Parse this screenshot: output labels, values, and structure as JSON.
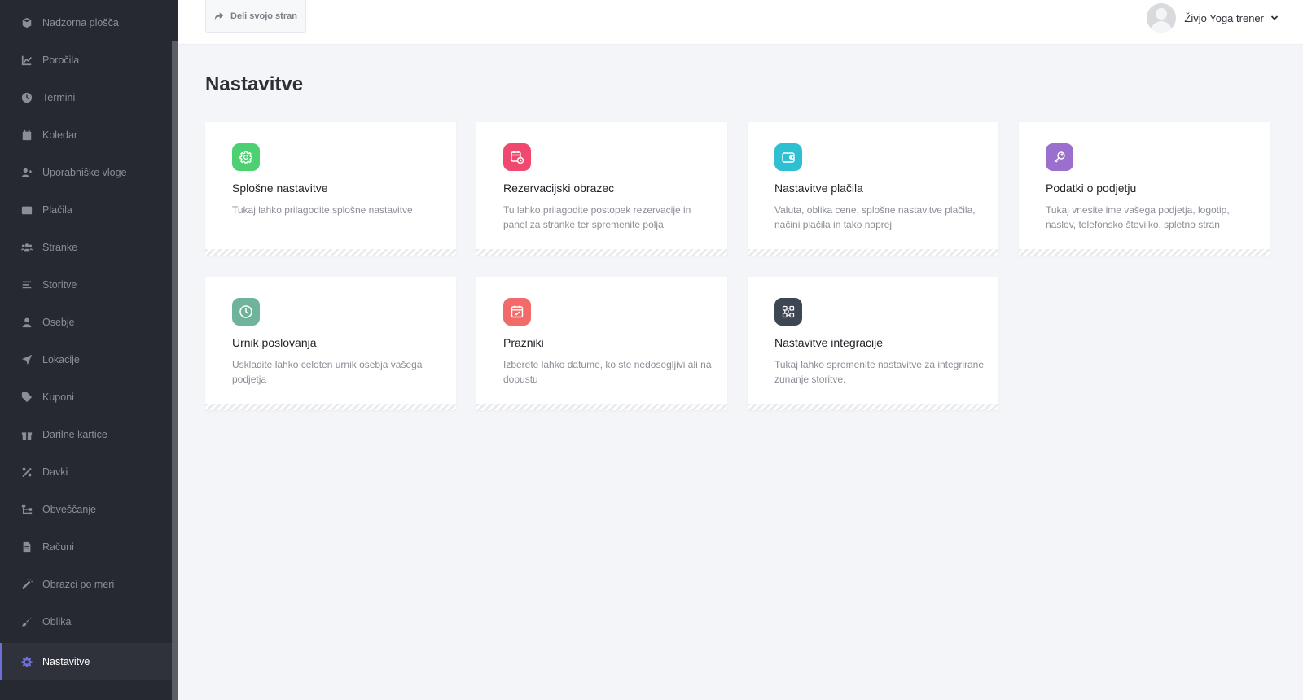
{
  "sidebar": {
    "items": [
      {
        "label": "Nadzorna plošča",
        "icon": "dashboard-icon"
      },
      {
        "label": "Poročila",
        "icon": "chart-line-icon"
      },
      {
        "label": "Termini",
        "icon": "clock-icon"
      },
      {
        "label": "Koledar",
        "icon": "calendar-icon"
      },
      {
        "label": "Uporabniške vloge",
        "icon": "user-plus-icon"
      },
      {
        "label": "Plačila",
        "icon": "wallet-icon"
      },
      {
        "label": "Stranke",
        "icon": "users-icon"
      },
      {
        "label": "Storitve",
        "icon": "list-icon"
      },
      {
        "label": "Osebje",
        "icon": "user-icon"
      },
      {
        "label": "Lokacije",
        "icon": "location-arrow-icon"
      },
      {
        "label": "Kuponi",
        "icon": "tag-icon"
      },
      {
        "label": "Darilne kartice",
        "icon": "gift-icon"
      },
      {
        "label": "Davki",
        "icon": "percent-icon"
      },
      {
        "label": "Obveščanje",
        "icon": "sitemap-icon"
      },
      {
        "label": "Računi",
        "icon": "invoice-icon"
      },
      {
        "label": "Obrazci po meri",
        "icon": "magic-wand-icon"
      },
      {
        "label": "Oblika",
        "icon": "paint-brush-icon"
      },
      {
        "label": "Nastavitve",
        "icon": "gear-icon",
        "active": true
      }
    ]
  },
  "topbar": {
    "share_label": "Deli svojo stran",
    "user_name": "Živjo Yoga trener"
  },
  "page": {
    "title": "Nastavitve"
  },
  "cards": [
    {
      "title": "Splošne nastavitve",
      "desc": "Tukaj lahko prilagodite splošne nastavitve",
      "icon": "gear-icon",
      "color": "#4cd072"
    },
    {
      "title": "Rezervacijski obrazec",
      "desc": "Tu lahko prilagodite postopek rezervacije in panel za stranke ter spremenite polja",
      "icon": "calendar-clock-icon",
      "color": "#f0486f"
    },
    {
      "title": "Nastavitve plačila",
      "desc": "Valuta, oblika cene, splošne nastavitve plačila, načini plačila in tako naprej",
      "icon": "wallet-icon",
      "color": "#2ec0d2"
    },
    {
      "title": "Podatki o podjetju",
      "desc": "Tukaj vnesite ime vašega podjetja, logotip, naslov, telefonsko številko, spletno stran",
      "icon": "key-icon",
      "color": "#9a6fce"
    },
    {
      "title": "Urnik poslovanja",
      "desc": "Uskladite lahko celoten urnik osebja vašega podjetja",
      "icon": "clock-icon",
      "color": "#6fb39b"
    },
    {
      "title": "Prazniki",
      "desc": "Izberete lahko datume, ko ste nedosegljivi ali na dopustu",
      "icon": "calendar-check-icon",
      "color": "#f36a6a"
    },
    {
      "title": "Nastavitve integracije",
      "desc": "Tukaj lahko spremenite nastavitve za integrirane zunanje storitve.",
      "icon": "integration-grid-icon",
      "color": "#3e4654"
    }
  ]
}
